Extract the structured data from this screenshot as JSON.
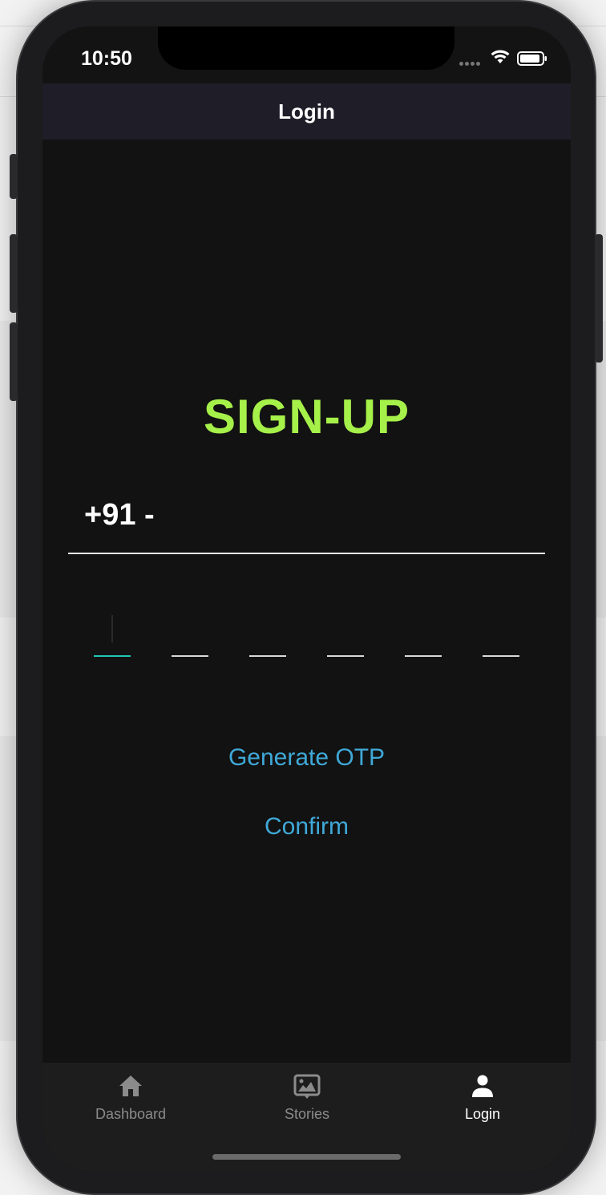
{
  "status_bar": {
    "time": "10:50"
  },
  "nav": {
    "title": "Login"
  },
  "form": {
    "title": "SIGN-UP",
    "country_code": "+91 -",
    "phone_value": "",
    "otp_digits": [
      "",
      "",
      "",
      "",
      "",
      ""
    ]
  },
  "actions": {
    "generate_otp": "Generate OTP",
    "confirm": "Confirm"
  },
  "tabs": [
    {
      "label": "Dashboard",
      "icon": "home-icon",
      "active": false
    },
    {
      "label": "Stories",
      "icon": "stories-icon",
      "active": false
    },
    {
      "label": "Login",
      "icon": "person-icon",
      "active": true
    }
  ],
  "colors": {
    "accent_green": "#a6f04a",
    "link_blue": "#3fa9d8",
    "otp_active": "#1fc7b6"
  }
}
